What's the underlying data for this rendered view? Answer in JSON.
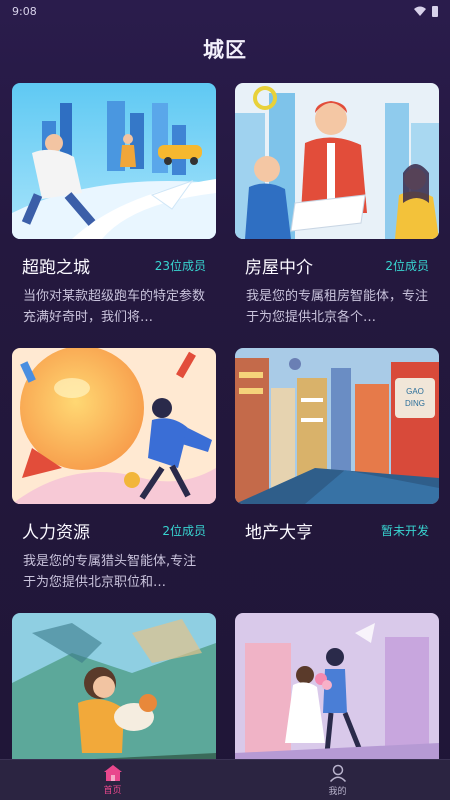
{
  "status": {
    "time": "9:08"
  },
  "header": {
    "title": "城区"
  },
  "cards": [
    {
      "name": "超跑之城",
      "badge": "23位成员",
      "desc": "当你对某款超级跑车的特定参数充满好奇时，我们将…"
    },
    {
      "name": "房屋中介",
      "badge": "2位成员",
      "desc": "我是您的专属租房智能体，专注于为您提供北京各个…"
    },
    {
      "name": "人力资源",
      "badge": "2位成员",
      "desc": "我是您的专属猎头智能体,专注于为您提供北京职位和…"
    },
    {
      "name": "地产大亨",
      "badge": "暂未开发",
      "desc": ""
    },
    {
      "name": "",
      "badge": "",
      "desc": ""
    },
    {
      "name": "",
      "badge": "",
      "desc": ""
    }
  ],
  "tabbar": {
    "items": [
      {
        "label": "首页",
        "icon": "home-icon",
        "active": true
      },
      {
        "label": "我的",
        "icon": "profile-icon",
        "active": false
      }
    ]
  },
  "colors": {
    "accent": "#e9478d",
    "badge": "#38d4d0",
    "background": "#24183f"
  }
}
